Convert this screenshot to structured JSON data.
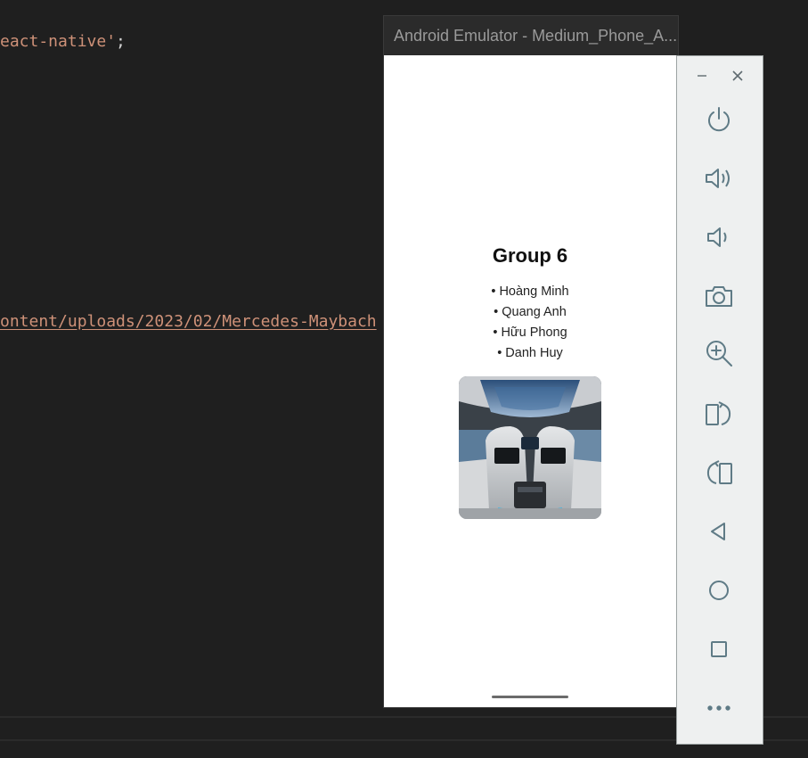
{
  "editor": {
    "lines": [
      {
        "string": "eact-native'",
        "punct": ";"
      },
      {
        "string": "ontent/uploads/2023/02/Mercedes-Maybach"
      }
    ]
  },
  "emulator": {
    "title": "Android Emulator - Medium_Phone_A..."
  },
  "app": {
    "title": "Group 6",
    "bullet": "•",
    "members": [
      "Hoàng Minh",
      "Quang Anh",
      "Hữu Phong",
      "Danh Huy"
    ],
    "image": {
      "subject": "Mercedes-Maybach interior"
    }
  },
  "side_panel": {
    "window_controls": [
      "minimize-icon",
      "close-icon"
    ],
    "buttons": [
      "power-icon",
      "volume-up-icon",
      "volume-down-icon",
      "camera-icon",
      "zoom-icon",
      "rotate-left-icon",
      "rotate-right-icon",
      "back-icon",
      "home-icon",
      "overview-icon",
      "more-icon"
    ],
    "icon_color": "#5f7b86"
  }
}
